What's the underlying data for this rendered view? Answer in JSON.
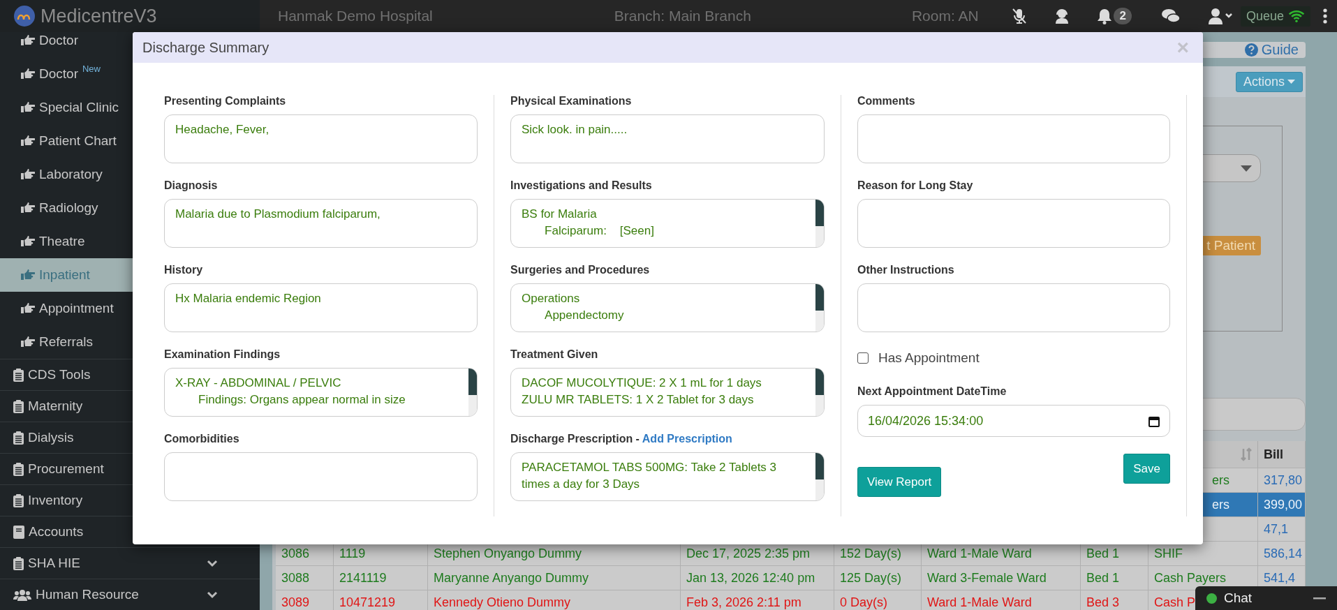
{
  "topbar": {
    "app_name": "MedicentreV3",
    "hospital": "Hanmak Demo Hospital",
    "branch": "Branch: Main Branch",
    "room": "Room: AN",
    "notification_count": "2",
    "queue_button": "Queue"
  },
  "sidebar": {
    "items": [
      {
        "label": "Doctor",
        "kind": "link",
        "selected": false
      },
      {
        "label": "Doctor",
        "badge": "New",
        "kind": "link",
        "selected": false
      },
      {
        "label": "Special Clinic",
        "kind": "link",
        "selected": false
      },
      {
        "label": "Patient Chart",
        "kind": "link",
        "selected": false
      },
      {
        "label": "Laboratory",
        "kind": "link",
        "selected": false
      },
      {
        "label": "Radiology",
        "kind": "link",
        "selected": false
      },
      {
        "label": "Theatre",
        "kind": "link",
        "selected": false
      },
      {
        "label": "Inpatient",
        "kind": "link",
        "selected": true
      },
      {
        "label": "Appointment",
        "kind": "link",
        "selected": false
      },
      {
        "label": "Referrals",
        "kind": "link",
        "selected": false
      },
      {
        "label": "CDS Tools",
        "kind": "module",
        "selected": false
      },
      {
        "label": "Maternity",
        "kind": "module",
        "selected": false
      },
      {
        "label": "Dialysis",
        "kind": "module",
        "selected": false
      },
      {
        "label": "Procurement",
        "kind": "module",
        "selected": false
      },
      {
        "label": "Inventory",
        "kind": "module",
        "selected": false
      },
      {
        "label": "Accounts",
        "kind": "ledger",
        "selected": false
      },
      {
        "label": "SHA HIE",
        "kind": "module",
        "selected": false,
        "expandable": true
      },
      {
        "label": "Human Resource",
        "kind": "people",
        "selected": false,
        "expandable": true
      }
    ]
  },
  "page": {
    "guide_link": "Guide",
    "actions_button": "Actions",
    "patient_button": "t Patient"
  },
  "table": {
    "last_column": "Bill",
    "rows": [
      {
        "payer": "ers",
        "bill": "317,80",
        "selected": false,
        "color": "#1e7b1e"
      },
      {
        "payer": "ers",
        "bill": "399,00",
        "selected": true
      },
      {
        "bill": "47,1",
        "selected": false
      },
      {
        "id": "3086",
        "number": "1119",
        "name": "Stephen Onyango Dummy",
        "admitted": "Dec 17, 2025 2:35 pm",
        "stay": "152 Day(s)",
        "ward": "Ward 1-Male Ward",
        "bed": "Bed 1",
        "payer": "SHIF",
        "bill": "586,14",
        "selected": false,
        "color": "#1e7b1e"
      },
      {
        "id": "3088",
        "number": "2141119",
        "name": "Maryanne Anyango Dummy",
        "admitted": "Jan 13, 2026 12:40 pm",
        "stay": "125 Day(s)",
        "ward": "Ward 3-Female Ward",
        "bed": "Bed 1",
        "payer": "Cash Payers",
        "bill": "541,4",
        "selected": false,
        "color": "#1e7b1e"
      },
      {
        "id": "3089",
        "number": "10471219",
        "name": "Kennedy Otieno Dummy",
        "admitted": "Feb 3, 2026 2:11 pm",
        "stay": "0 Day(s)",
        "ward": "Ward 1-Male Ward",
        "bed": "Bed 3",
        "payer": "Cash P",
        "selected": false,
        "color": "#e01515"
      }
    ]
  },
  "dialog": {
    "title": "Discharge Summary",
    "close": "×",
    "columns": [
      {
        "fields": [
          {
            "label": "Presenting Complaints",
            "value": "Headache, Fever,",
            "scrollbar": false
          },
          {
            "label": "Diagnosis",
            "value": "Malaria due to Plasmodium falciparum,",
            "scrollbar": false
          },
          {
            "label": "History",
            "value": "Hx Malaria endemic Region",
            "scrollbar": false
          },
          {
            "label": "Examination Findings",
            "value": "X-RAY - ABDOMINAL / PELVIC\n       Findings: Organs appear normal in size",
            "scrollbar": true
          },
          {
            "label": "Comorbidities",
            "scrollbar": false
          }
        ]
      },
      {
        "fields": [
          {
            "label": "Physical Examinations",
            "value": "Sick look. in pain.....",
            "scrollbar": false
          },
          {
            "label": "Investigations and Results",
            "value": "BS for Malaria\n       Falciparum:    [Seen]",
            "scrollbar": true
          },
          {
            "label": "Surgeries and Procedures",
            "value": "Operations\n       Appendectomy",
            "scrollbar": true
          },
          {
            "label": "Treatment Given",
            "value": "DACOF MUCOLYTIQUE: 2 X 1 mL for 1 days\nZULU MR TABLETS: 1 X 2 Tablet for 3 days",
            "scrollbar": true
          },
          {
            "label": "Discharge Prescription -",
            "link": "Add Prescription",
            "value": "PARACETAMOL TABS 500MG: Take 2 Tablets 3 times a day for 3 Days",
            "scrollbar": true
          }
        ]
      },
      {
        "fields": [
          {
            "label": "Comments",
            "scrollbar": false
          },
          {
            "label": "Reason for Long Stay",
            "scrollbar": false
          },
          {
            "label": "Other Instructions",
            "scrollbar": false
          }
        ],
        "checkbox": {
          "label": "Has Appointment",
          "checked": false
        },
        "date_field": {
          "label": "Next Appointment DateTime",
          "value": "16/04/2026 15:34:00"
        }
      }
    ],
    "buttons": {
      "save": "Save",
      "view_report": "View Report"
    }
  },
  "chat": {
    "label": "Chat"
  }
}
